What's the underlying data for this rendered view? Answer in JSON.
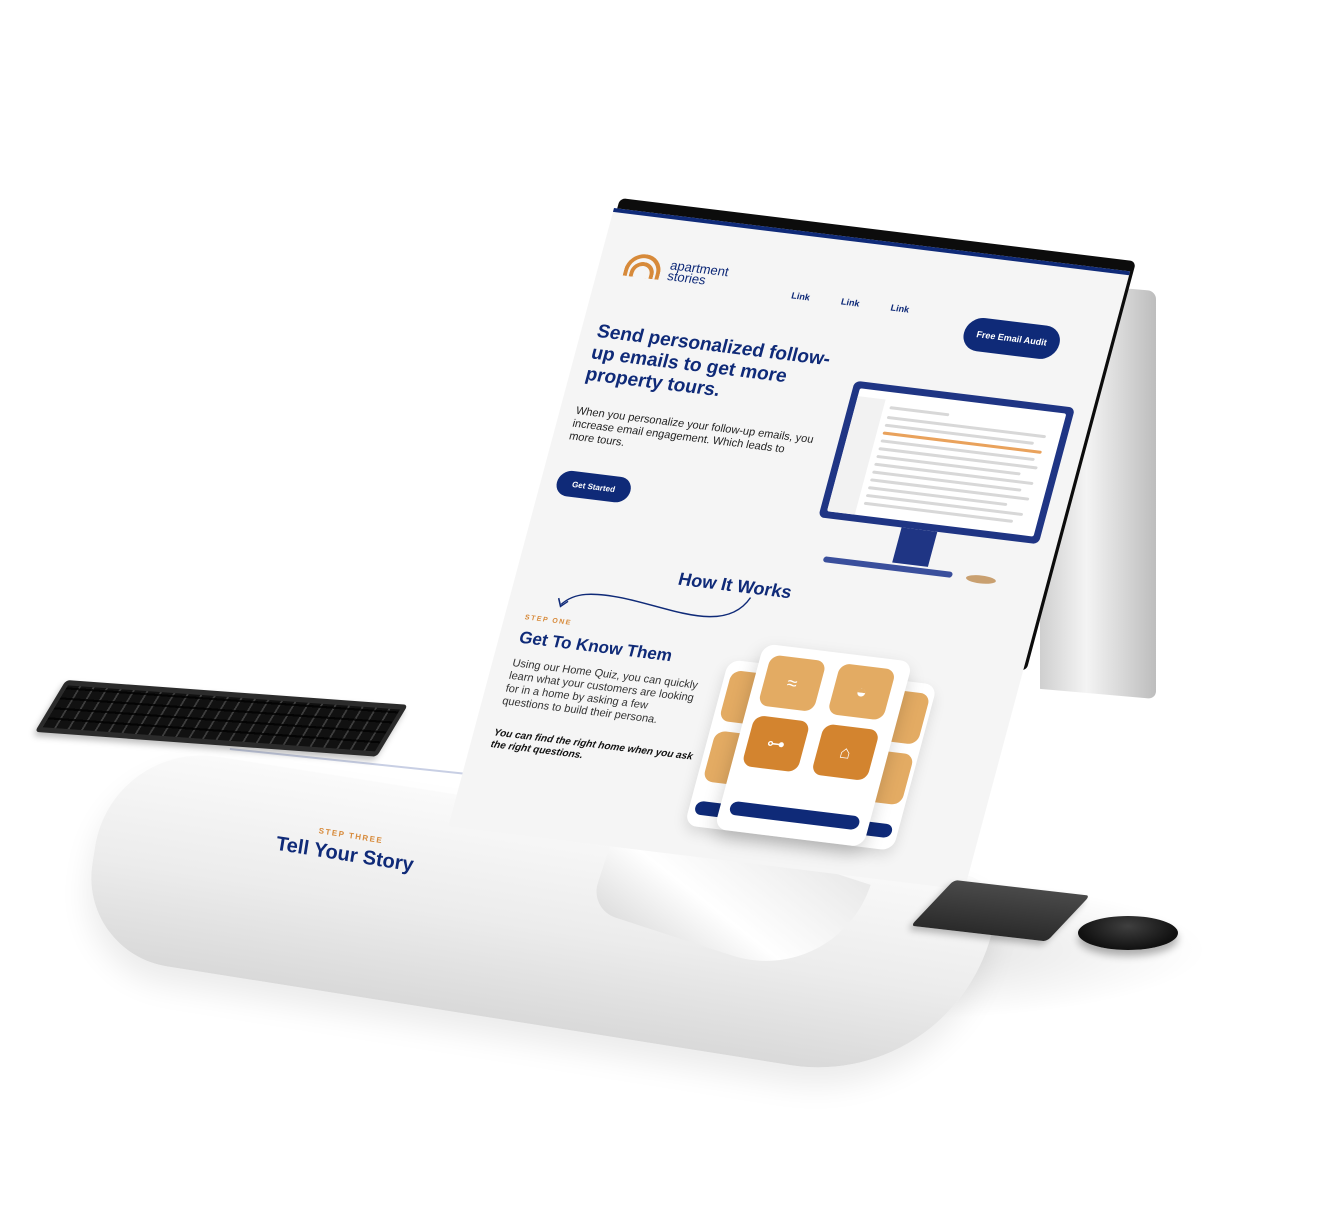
{
  "nav": {
    "logo_line1": "apartment",
    "logo_line2": "stories",
    "links": [
      "Link",
      "Link",
      "Link"
    ],
    "cta": "Free Email Audit"
  },
  "hero": {
    "title": "Send personalized follow-up emails to get more property tours.",
    "body": "When you personalize your follow-up emails, you increase email engagement. Which leads to more tours.",
    "button": "Get Started"
  },
  "how_it_works": {
    "title": "How It Works",
    "step_one": {
      "label": "STEP ONE",
      "title": "Get To Know Them",
      "body": "Using our Home Quiz, you can quickly learn what your customers are looking for in a home by asking a few questions to build their persona.",
      "emphasis": "You can find the right home when you ask the right questions."
    },
    "step_three": {
      "label": "STEP THREE",
      "title": "Tell Your Story"
    }
  },
  "quiz_icons": [
    "waves-icon",
    "pool-icon",
    "dumbbell-icon",
    "garage-icon"
  ],
  "colors": {
    "navy": "#0f2a78",
    "orange": "#d78a3a",
    "tile": "#e3ab63",
    "tile_dark": "#d3842f"
  }
}
